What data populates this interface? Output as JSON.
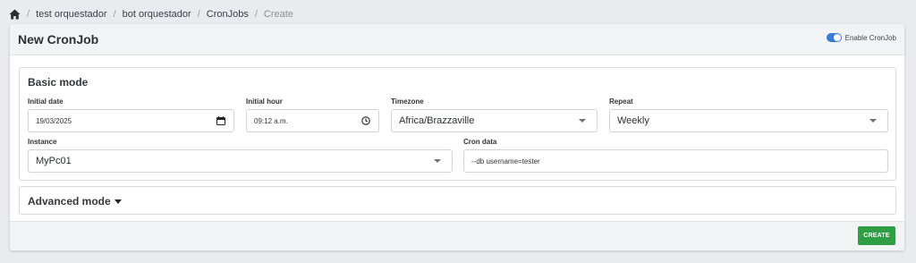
{
  "breadcrumb": {
    "items": [
      "test orquestador",
      "bot orquestador",
      "CronJobs",
      "Create"
    ]
  },
  "header": {
    "title": "New CronJob",
    "toggle_label": "Enable CronJob",
    "toggle_on": true
  },
  "basic": {
    "title": "Basic mode",
    "initial_date_label": "Initial date",
    "initial_date_value": "19/03/2025",
    "initial_hour_label": "Initial hour",
    "initial_hour_value": "09:12 a.m.",
    "timezone_label": "Timezone",
    "timezone_value": "Africa/Brazzaville",
    "repeat_label": "Repeat",
    "repeat_value": "Weekly",
    "instance_label": "Instance",
    "instance_value": "MyPc01",
    "cron_data_label": "Cron data",
    "cron_data_value": "--db username=tester"
  },
  "advanced": {
    "title": "Advanced mode"
  },
  "footer": {
    "create_label": "CREATE"
  },
  "colors": {
    "accent": "#3a7bd5",
    "create_button": "#2f9e44"
  },
  "icons": {
    "home": "home-icon",
    "calendar": "calendar-icon",
    "clock": "clock-icon",
    "dropdown": "chevron-down-icon"
  }
}
